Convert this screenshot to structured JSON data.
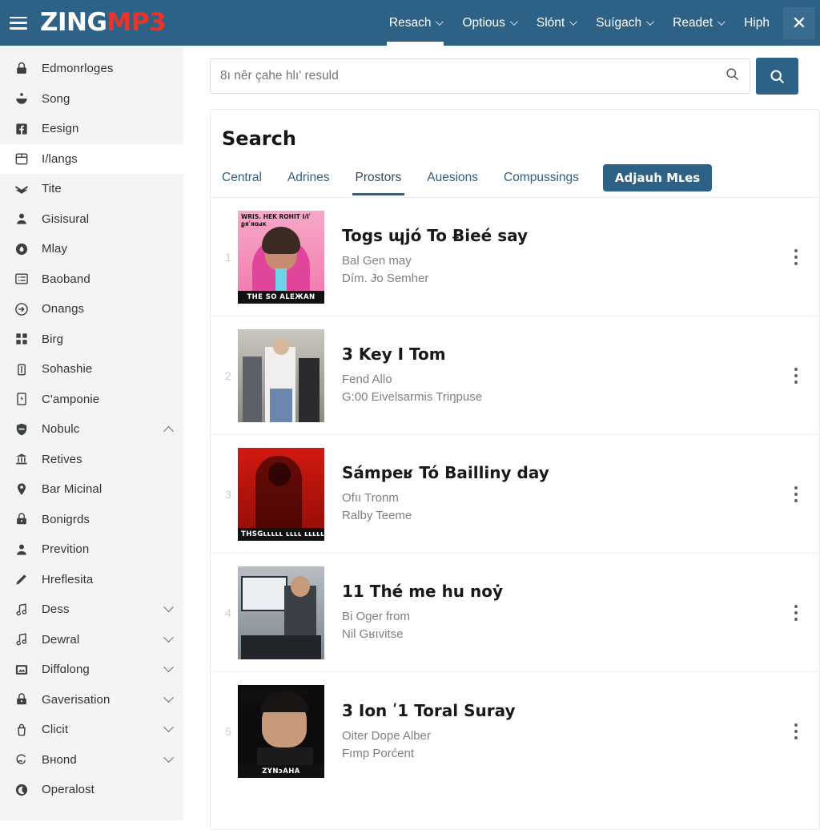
{
  "header": {
    "logo_zing": "ZING",
    "logo_mp3": "MP3",
    "menu_icon": "hamburger-icon",
    "close_label": "✕",
    "accent_color": "#2e6186",
    "logo_accent_color": "#e8352c",
    "nav": [
      {
        "label": "Resach",
        "has_caret": true,
        "active": true
      },
      {
        "label": "Optious",
        "has_caret": true,
        "active": false
      },
      {
        "label": "Slónt",
        "has_caret": true,
        "active": false
      },
      {
        "label": "Suígach",
        "has_caret": true,
        "active": false
      },
      {
        "label": "Readet",
        "has_caret": true,
        "active": false
      },
      {
        "label": "Hiрh",
        "has_caret": false,
        "active": false
      }
    ]
  },
  "sidebar": {
    "items": [
      {
        "label": "Edmonrloges",
        "icon": "lock-icon",
        "chevron": "none"
      },
      {
        "label": "Song",
        "icon": "bowl-icon",
        "chevron": "none"
      },
      {
        "label": "Eesign",
        "icon": "facebook-icon",
        "chevron": "none"
      },
      {
        "label": "I/langs",
        "icon": "calendar-icon",
        "chevron": "none",
        "selected": true
      },
      {
        "label": "Tite",
        "icon": "chevron-stack-icon",
        "chevron": "none"
      },
      {
        "label": "Gisisural",
        "icon": "person-icon",
        "chevron": "none"
      },
      {
        "label": "Mlay",
        "icon": "droplet-circle-icon",
        "chevron": "none"
      },
      {
        "label": "Baoband",
        "icon": "list-icon",
        "chevron": "none"
      },
      {
        "label": "Onangs",
        "icon": "arrow-circle-icon",
        "chevron": "none"
      },
      {
        "label": "Birg",
        "icon": "grid-icon",
        "chevron": "none"
      },
      {
        "label": "Sohashie",
        "icon": "trash-icon",
        "chevron": "none"
      },
      {
        "label": "C'amponie",
        "icon": "document-icon",
        "chevron": "none"
      },
      {
        "label": "Nobulc",
        "icon": "shield-icon",
        "chevron": "up"
      },
      {
        "label": "Retives",
        "icon": "bank-icon",
        "chevron": "none"
      },
      {
        "label": "Bar Micinal",
        "icon": "pin-icon",
        "chevron": "none"
      },
      {
        "label": "Bonigrds",
        "icon": "padlock-icon",
        "chevron": "none"
      },
      {
        "label": "Prevition",
        "icon": "person-icon",
        "chevron": "none"
      },
      {
        "label": "Hreflesita",
        "icon": "pencil-icon",
        "chevron": "none"
      },
      {
        "label": "Dess",
        "icon": "music-note-icon",
        "chevron": "down"
      },
      {
        "label": "Dewral",
        "icon": "music-note-icon",
        "chevron": "down"
      },
      {
        "label": "Diffɑlong",
        "icon": "image-icon",
        "chevron": "down"
      },
      {
        "label": "Gaverisation",
        "icon": "padlock-icon",
        "chevron": "down"
      },
      {
        "label": "Clicit",
        "icon": "bag-icon",
        "chevron": "down"
      },
      {
        "label": "Bнond",
        "icon": "swirl-icon",
        "chevron": "down"
      },
      {
        "label": "Operalost",
        "icon": "moon-icon",
        "chevron": "none"
      }
    ]
  },
  "search": {
    "placeholder": "8ı nêr çahe hlıʹ resuld",
    "value": "",
    "input_icon": "search-icon",
    "button_icon": "search-icon"
  },
  "panel": {
    "title": "Search",
    "tabs": [
      {
        "label": "Central",
        "active": false
      },
      {
        "label": "Adrines",
        "active": false
      },
      {
        "label": "Prostors",
        "active": true
      },
      {
        "label": "Auesions",
        "active": false
      },
      {
        "label": "Compussings",
        "active": false
      }
    ],
    "action_button": "Adjаuһ Mʟes"
  },
  "results": [
    {
      "number": "1",
      "title": "Togs ɰjó To Ƀieé say",
      "line1": "Bal Gen may",
      "line2": "Dím. Ɉo Semher",
      "art": {
        "style": "pink-portrait",
        "top_text": "WRIS. HEK ROHIT\nI/Iʹ քяʹяɑԁк",
        "caption": "THE SO ALEЖAN"
      }
    },
    {
      "number": "2",
      "title": "3 Key I Tom",
      "line1": "Fend Allo",
      "line2": "G:00 Eivelsarmis Triŋpuse",
      "art": {
        "style": "group-photo",
        "top_text": "",
        "caption": ""
      }
    },
    {
      "number": "3",
      "title": "Sámpeʁ Tó Bailliny day",
      "line1": "Ofıı Tronm",
      "line2": "Ralby Teeme",
      "art": {
        "style": "red-poster",
        "top_text": "",
        "caption": "THSGʟʟʟʟʟ ʟʟʟʟ ʟʟʟʟʟʟʟ"
      }
    },
    {
      "number": "4",
      "title": "11 Thé me hu noẏ",
      "line1": "Bi Oger from",
      "line2": "Nil Gʁıvitse",
      "art": {
        "style": "presenter-photo",
        "top_text": "",
        "caption": ""
      }
    },
    {
      "number": "5",
      "title": "3 Ion ʹ1 Toral Suray",
      "line1": "Oiter Dope Alber",
      "line2": "Fımp Porćent",
      "art": {
        "style": "dark-portrait",
        "top_text": "▒▒▒▒▒▒▒▒\n▒▒▒▒▒▒\n▒▒▒▒▒▒▒▒▒",
        "caption": "ZҰNɔAHA"
      }
    }
  ]
}
